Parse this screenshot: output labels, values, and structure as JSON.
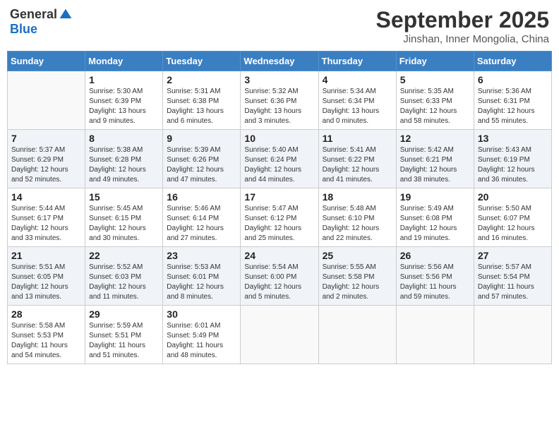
{
  "header": {
    "logo_general": "General",
    "logo_blue": "Blue",
    "month_title": "September 2025",
    "subtitle": "Jinshan, Inner Mongolia, China"
  },
  "calendar": {
    "weekdays": [
      "Sunday",
      "Monday",
      "Tuesday",
      "Wednesday",
      "Thursday",
      "Friday",
      "Saturday"
    ],
    "weeks": [
      [
        {
          "day": "",
          "info": ""
        },
        {
          "day": "1",
          "info": "Sunrise: 5:30 AM\nSunset: 6:39 PM\nDaylight: 13 hours\nand 9 minutes."
        },
        {
          "day": "2",
          "info": "Sunrise: 5:31 AM\nSunset: 6:38 PM\nDaylight: 13 hours\nand 6 minutes."
        },
        {
          "day": "3",
          "info": "Sunrise: 5:32 AM\nSunset: 6:36 PM\nDaylight: 13 hours\nand 3 minutes."
        },
        {
          "day": "4",
          "info": "Sunrise: 5:34 AM\nSunset: 6:34 PM\nDaylight: 13 hours\nand 0 minutes."
        },
        {
          "day": "5",
          "info": "Sunrise: 5:35 AM\nSunset: 6:33 PM\nDaylight: 12 hours\nand 58 minutes."
        },
        {
          "day": "6",
          "info": "Sunrise: 5:36 AM\nSunset: 6:31 PM\nDaylight: 12 hours\nand 55 minutes."
        }
      ],
      [
        {
          "day": "7",
          "info": "Sunrise: 5:37 AM\nSunset: 6:29 PM\nDaylight: 12 hours\nand 52 minutes."
        },
        {
          "day": "8",
          "info": "Sunrise: 5:38 AM\nSunset: 6:28 PM\nDaylight: 12 hours\nand 49 minutes."
        },
        {
          "day": "9",
          "info": "Sunrise: 5:39 AM\nSunset: 6:26 PM\nDaylight: 12 hours\nand 47 minutes."
        },
        {
          "day": "10",
          "info": "Sunrise: 5:40 AM\nSunset: 6:24 PM\nDaylight: 12 hours\nand 44 minutes."
        },
        {
          "day": "11",
          "info": "Sunrise: 5:41 AM\nSunset: 6:22 PM\nDaylight: 12 hours\nand 41 minutes."
        },
        {
          "day": "12",
          "info": "Sunrise: 5:42 AM\nSunset: 6:21 PM\nDaylight: 12 hours\nand 38 minutes."
        },
        {
          "day": "13",
          "info": "Sunrise: 5:43 AM\nSunset: 6:19 PM\nDaylight: 12 hours\nand 36 minutes."
        }
      ],
      [
        {
          "day": "14",
          "info": "Sunrise: 5:44 AM\nSunset: 6:17 PM\nDaylight: 12 hours\nand 33 minutes."
        },
        {
          "day": "15",
          "info": "Sunrise: 5:45 AM\nSunset: 6:15 PM\nDaylight: 12 hours\nand 30 minutes."
        },
        {
          "day": "16",
          "info": "Sunrise: 5:46 AM\nSunset: 6:14 PM\nDaylight: 12 hours\nand 27 minutes."
        },
        {
          "day": "17",
          "info": "Sunrise: 5:47 AM\nSunset: 6:12 PM\nDaylight: 12 hours\nand 25 minutes."
        },
        {
          "day": "18",
          "info": "Sunrise: 5:48 AM\nSunset: 6:10 PM\nDaylight: 12 hours\nand 22 minutes."
        },
        {
          "day": "19",
          "info": "Sunrise: 5:49 AM\nSunset: 6:08 PM\nDaylight: 12 hours\nand 19 minutes."
        },
        {
          "day": "20",
          "info": "Sunrise: 5:50 AM\nSunset: 6:07 PM\nDaylight: 12 hours\nand 16 minutes."
        }
      ],
      [
        {
          "day": "21",
          "info": "Sunrise: 5:51 AM\nSunset: 6:05 PM\nDaylight: 12 hours\nand 13 minutes."
        },
        {
          "day": "22",
          "info": "Sunrise: 5:52 AM\nSunset: 6:03 PM\nDaylight: 12 hours\nand 11 minutes."
        },
        {
          "day": "23",
          "info": "Sunrise: 5:53 AM\nSunset: 6:01 PM\nDaylight: 12 hours\nand 8 minutes."
        },
        {
          "day": "24",
          "info": "Sunrise: 5:54 AM\nSunset: 6:00 PM\nDaylight: 12 hours\nand 5 minutes."
        },
        {
          "day": "25",
          "info": "Sunrise: 5:55 AM\nSunset: 5:58 PM\nDaylight: 12 hours\nand 2 minutes."
        },
        {
          "day": "26",
          "info": "Sunrise: 5:56 AM\nSunset: 5:56 PM\nDaylight: 11 hours\nand 59 minutes."
        },
        {
          "day": "27",
          "info": "Sunrise: 5:57 AM\nSunset: 5:54 PM\nDaylight: 11 hours\nand 57 minutes."
        }
      ],
      [
        {
          "day": "28",
          "info": "Sunrise: 5:58 AM\nSunset: 5:53 PM\nDaylight: 11 hours\nand 54 minutes."
        },
        {
          "day": "29",
          "info": "Sunrise: 5:59 AM\nSunset: 5:51 PM\nDaylight: 11 hours\nand 51 minutes."
        },
        {
          "day": "30",
          "info": "Sunrise: 6:01 AM\nSunset: 5:49 PM\nDaylight: 11 hours\nand 48 minutes."
        },
        {
          "day": "",
          "info": ""
        },
        {
          "day": "",
          "info": ""
        },
        {
          "day": "",
          "info": ""
        },
        {
          "day": "",
          "info": ""
        }
      ]
    ]
  }
}
